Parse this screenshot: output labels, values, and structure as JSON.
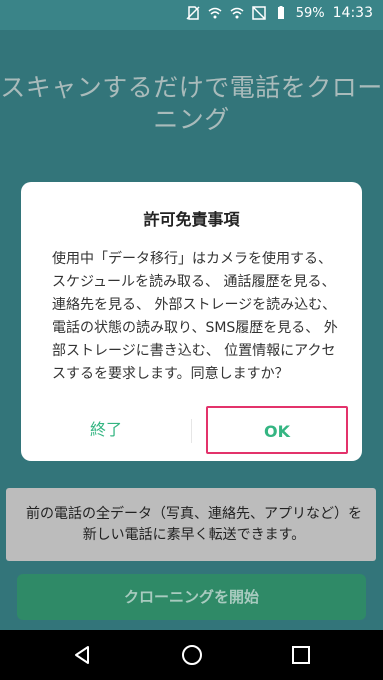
{
  "status_bar": {
    "battery_percent": "59%",
    "time": "14:33",
    "icons": [
      "no-sim-icon",
      "wifi-icon",
      "wifi-icon",
      "airplane-icon",
      "battery-icon"
    ]
  },
  "background": {
    "title": "スキャンするだけで電話をクローニング"
  },
  "dialog": {
    "title": "許可免責事項",
    "message": "使用中「データ移行」はカメラを使用する、 スケジュールを読み取る、 通話履歴を見る、 連絡先を見る、 外部ストレージを読み込む、 電話の状態の読み取り、SMS履歴を見る、 外部ストレージに書き込む、 位置情報にアクセスするを要求します。同意しますか？",
    "exit_label": "終了",
    "ok_label": "OK"
  },
  "info_card": {
    "text": "前の電話の全データ（写真、連絡先、アプリなど）を新しい電話に素早く転送できます。"
  },
  "start_button": {
    "label": "クローニングを開始"
  },
  "nav_bar": {
    "icons": [
      "back-icon",
      "home-icon",
      "recents-icon"
    ]
  },
  "colors": {
    "background": "#3f8f95",
    "accent_green": "#34b582",
    "highlight": "#e3326b"
  }
}
